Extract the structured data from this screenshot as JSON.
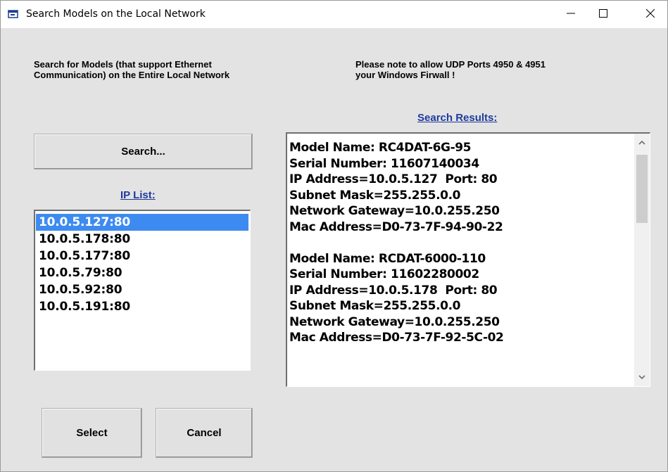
{
  "window": {
    "title": "Search Models on the Local Network",
    "icons": {
      "app": "app-window-icon",
      "minimize": "minimize-icon",
      "maximize": "maximize-icon",
      "close": "close-icon"
    }
  },
  "notes": {
    "left": "Search for Models (that support Ethernet\nCommunication) on the Entire Local Network",
    "right": "Please note to allow UDP Ports 4950 & 4951\nyour Windows Firwall !"
  },
  "buttons": {
    "search": "Search...",
    "select": "Select",
    "cancel": "Cancel"
  },
  "ip_list": {
    "label": "IP List:",
    "items": [
      "10.0.5.127:80",
      "10.0.5.178:80",
      "10.0.5.177:80",
      "10.0.5.79:80",
      "10.0.5.92:80",
      "10.0.5.191:80"
    ],
    "selected_index": 0
  },
  "results": {
    "label": "Search Results:",
    "lines": [
      "Model Name: RC4DAT-6G-95",
      "Serial Number: 11607140034",
      "IP Address=10.0.5.127  Port: 80",
      "Subnet Mask=255.255.0.0",
      "Network Gateway=10.0.255.250",
      "Mac Address=D0-73-7F-94-90-22",
      "",
      "Model Name: RCDAT-6000-110",
      "Serial Number: 11602280002",
      "IP Address=10.0.5.178  Port: 80",
      "Subnet Mask=255.255.0.0",
      "Network Gateway=10.0.255.250",
      "Mac Address=D0-73-7F-92-5C-02"
    ],
    "scrollbar_icons": {
      "up": "chevron-up-icon",
      "down": "chevron-down-icon"
    }
  },
  "colors": {
    "selection": "#3d8bf0",
    "link_label": "#1f3a9e",
    "client_bg": "#e3e3e3"
  }
}
